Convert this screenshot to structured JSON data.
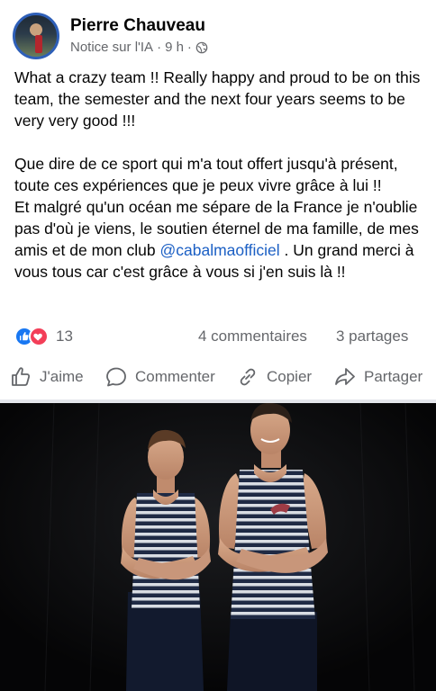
{
  "post": {
    "author": "Pierre Chauveau",
    "subtitle": "Notice sur l'IA",
    "time": "9 h",
    "separator": "·",
    "body": {
      "en": "What a crazy team !! Really happy and proud to be on this team, the semester and the next four years seems to be very very good !!!",
      "fr_1": "Que dire de ce sport qui m'a tout offert jusqu'à présent, toute ces expériences que je peux vivre grâce à lui !!",
      "fr_2": "Et malgré qu'un océan me sépare de la France je n'oublie pas d'où je viens, le soutien éternel de ma famille, de mes amis et de mon club",
      "mention": "@cabalmaofficiel",
      "fr_3": " . Un grand merci à vous tous car c'est grâce à vous si j'en suis là !!"
    },
    "stats": {
      "reaction_count": "13",
      "comments": "4 commentaires",
      "shares": "3 partages"
    },
    "actions": {
      "like": "J'aime",
      "comment": "Commenter",
      "copy": "Copier",
      "share": "Partager"
    }
  },
  "colors": {
    "accent": "#1877f2",
    "love": "#f33e58",
    "mention": "#1b5fc4",
    "secondary_text": "#65676b"
  },
  "icons": [
    "globe-icon",
    "like-reaction-icon",
    "love-reaction-icon",
    "thumbs-up-icon",
    "comment-bubble-icon",
    "link-icon",
    "share-arrow-icon"
  ]
}
